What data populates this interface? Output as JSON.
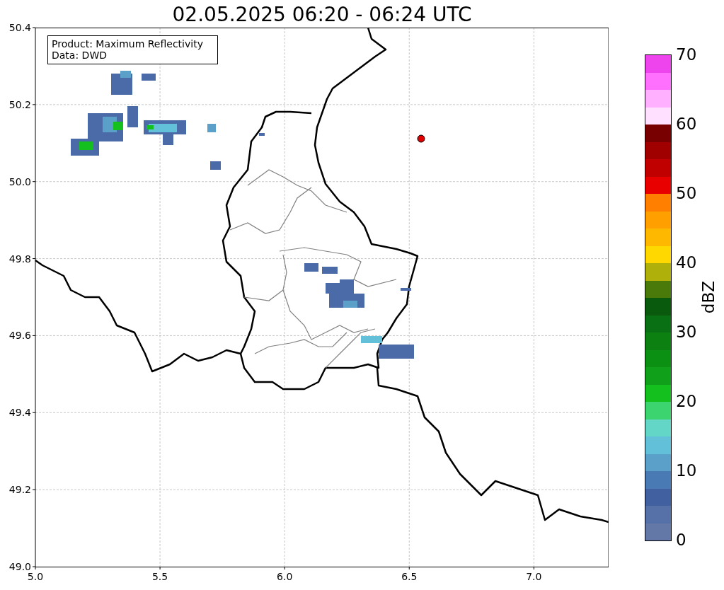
{
  "title": "02.05.2025 06:20 - 06:24 UTC",
  "map": {
    "info_box": {
      "lines": [
        "Product: Maximum Reflectivity",
        "Data: DWD"
      ]
    },
    "x_tick_labels": [
      "5.0",
      "5.5",
      "6.0",
      "6.5",
      "7.0"
    ],
    "y_tick_labels": [
      "50.4",
      "50.2",
      "50.0",
      "49.8",
      "49.6",
      "49.4",
      "49.2",
      "49.0"
    ]
  },
  "colorbar": {
    "label": "dBZ",
    "tick_labels": [
      "70",
      "60",
      "50",
      "40",
      "30",
      "20",
      "10",
      "0"
    ],
    "bands": [
      {
        "color": "#6478a8"
      },
      {
        "color": "#5670a8"
      },
      {
        "color": "#4060a0"
      },
      {
        "color": "#4a7ab4"
      },
      {
        "color": "#5aa0c8"
      },
      {
        "color": "#62c0d8"
      },
      {
        "color": "#64d6c8"
      },
      {
        "color": "#3cd46e"
      },
      {
        "color": "#14c01e"
      },
      {
        "color": "#10a01a"
      },
      {
        "color": "#0c9014"
      },
      {
        "color": "#0c8010"
      },
      {
        "color": "#0a7014"
      },
      {
        "color": "#0a5a0e"
      },
      {
        "color": "#4a7a0a"
      },
      {
        "color": "#b0b00a"
      },
      {
        "color": "#ffd800"
      },
      {
        "color": "#ffb800"
      },
      {
        "color": "#ffa000"
      },
      {
        "color": "#ff8000"
      },
      {
        "color": "#e80000"
      },
      {
        "color": "#c00000"
      },
      {
        "color": "#a00000"
      },
      {
        "color": "#780000"
      },
      {
        "color": "#ffe0ff"
      },
      {
        "color": "#ffb0ff"
      },
      {
        "color": "#ff70ff"
      },
      {
        "color": "#ee44ee"
      }
    ]
  }
}
